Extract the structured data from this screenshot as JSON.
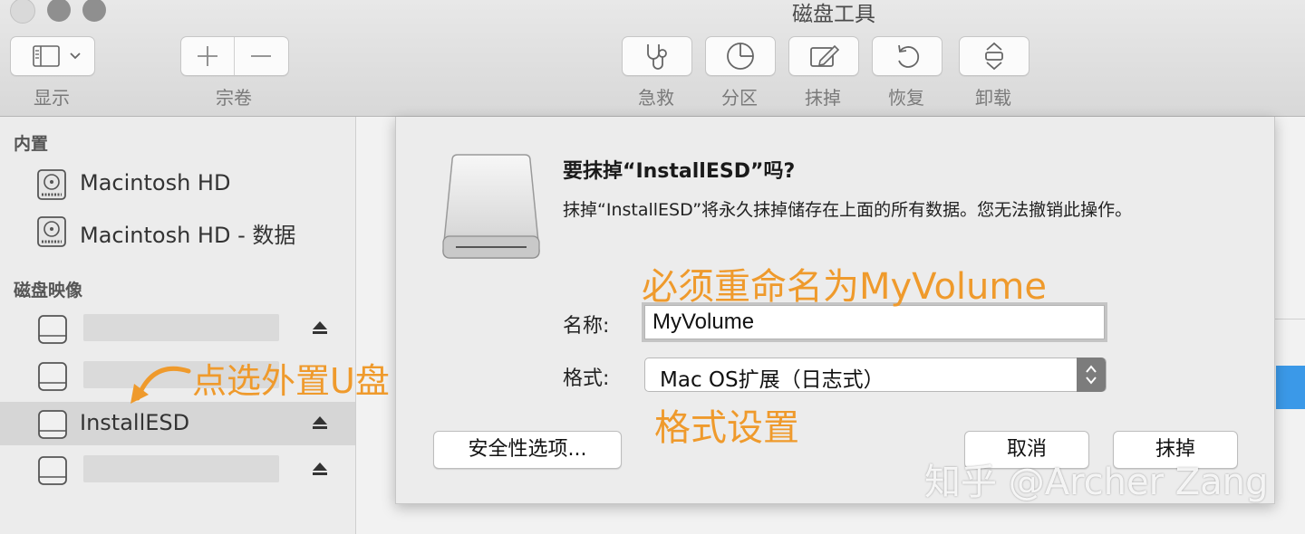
{
  "window": {
    "title": "磁盘工具"
  },
  "toolbar": {
    "view_label": "显示",
    "volume_label": "宗卷",
    "firstaid_label": "急救",
    "partition_label": "分区",
    "erase_label": "抹掉",
    "restore_label": "恢复",
    "unmount_label": "卸载"
  },
  "sidebar": {
    "internal_header": "内置",
    "internal_items": [
      "Macintosh HD",
      "Macintosh HD - 数据"
    ],
    "images_header": "磁盘映像",
    "image_items": [
      {
        "label": "",
        "redacted": true
      },
      {
        "label": "",
        "redacted": true
      },
      {
        "label": "InstallESD",
        "selected": true
      },
      {
        "label": "",
        "redacted": true
      }
    ]
  },
  "dialog": {
    "title": "要抹掉“InstallESD”吗?",
    "message": "抹掉“InstallESD”将永久抹掉储存在上面的所有数据。您无法撤销此操作。",
    "name_label": "名称:",
    "name_value": "MyVolume",
    "format_label": "格式:",
    "format_value": "Mac OS扩展（日志式）",
    "security_button": "安全性选项...",
    "cancel_button": "取消",
    "erase_button": "抹掉"
  },
  "annotations": {
    "rename_note": "必须重命名为MyVolume",
    "select_note": "点选外置U盘",
    "format_note": "格式设置",
    "color": "#ef9a2c"
  },
  "watermark": "知乎 @Archer Zang"
}
